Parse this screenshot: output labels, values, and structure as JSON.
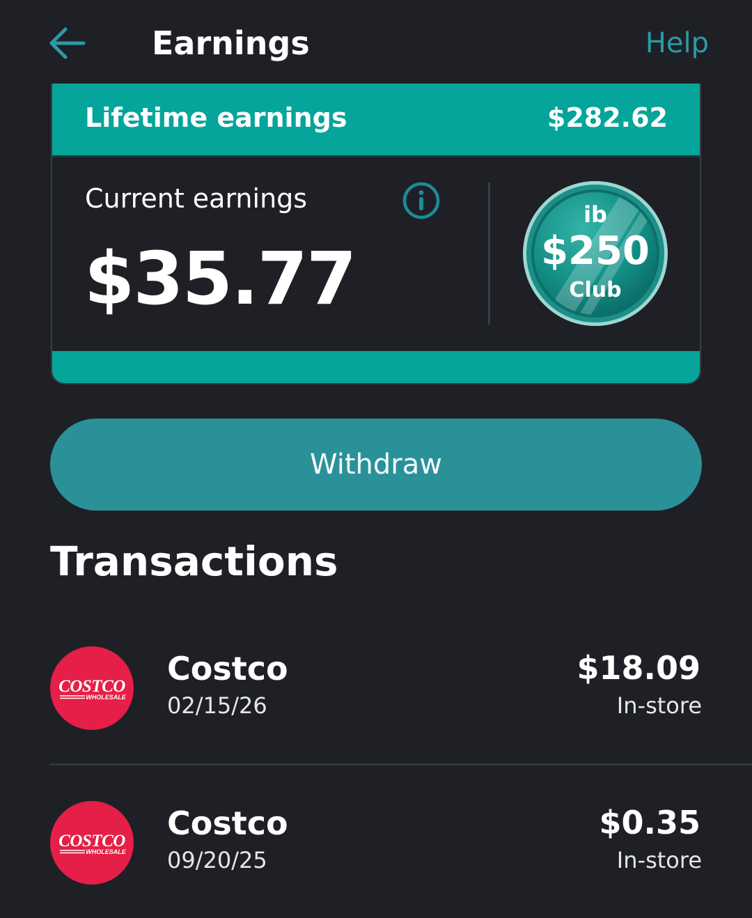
{
  "header": {
    "title": "Earnings",
    "help_label": "Help",
    "back_icon": "arrow-left-icon"
  },
  "earnings_card": {
    "lifetime_label": "Lifetime earnings",
    "lifetime_value": "$282.62",
    "current_label": "Current earnings",
    "info_icon": "info-icon",
    "current_value": "$35.77",
    "club_badge": {
      "brand": "ib",
      "amount": "$250",
      "label": "Club"
    }
  },
  "withdraw_label": "Withdraw",
  "transactions": {
    "heading": "Transactions",
    "items": [
      {
        "merchant": "Costco",
        "date": "02/15/26",
        "amount": "$18.09",
        "type": "In-store",
        "logo": "COSTCO WHOLESALE"
      },
      {
        "merchant": "Costco",
        "date": "09/20/25",
        "amount": "$0.35",
        "type": "In-store",
        "logo": "COSTCO WHOLESALE"
      }
    ]
  },
  "colors": {
    "background": "#1e2026",
    "accent_teal": "#05a59b",
    "button_teal": "#2b9199",
    "link_teal": "#2c9aa5",
    "costco_red": "#e51f47"
  }
}
